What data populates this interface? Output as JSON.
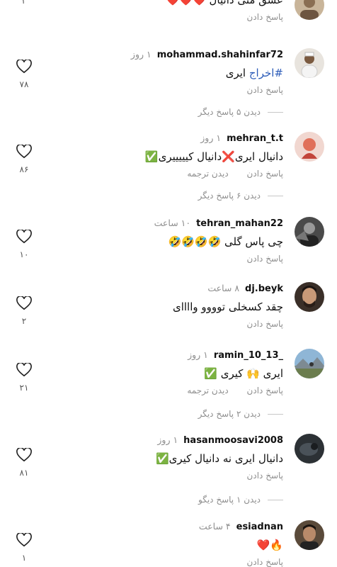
{
  "top_partial": {
    "text": "عشق منی دانیال ❤️❤️❤️",
    "reply": "پاسخ دادن",
    "likes": "۲"
  },
  "comments": [
    {
      "username": "mohammad.shahinfar72",
      "time": "۱ روز",
      "tag": "#اخراج",
      "text": " ایری",
      "actions": [
        "پاسخ دادن"
      ],
      "likes": "۷۸",
      "replies": "دیدن ۵ پاسخ دیگر"
    },
    {
      "username": "mehran_t.t",
      "time": "۱ روز",
      "text": "دانیال ایری❌دانیال کیییییری✅",
      "actions": [
        "پاسخ دادن",
        "دیدن ترجمه"
      ],
      "likes": "۸۶",
      "replies": "دیدن ۶ پاسخ دیگر"
    },
    {
      "username": "tehran_mahan22",
      "time": "۱۰ ساعت",
      "text": "چی پاس گلی 🤣🤣🤣🤣",
      "actions": [
        "پاسخ دادن"
      ],
      "likes": "۱۰"
    },
    {
      "username": "dj.beyk",
      "time": "۸ ساعت",
      "text": "چقد کسخلی توووو واااای",
      "actions": [
        "پاسخ دادن"
      ],
      "likes": "۲"
    },
    {
      "username": "ramin_10_13_",
      "time": "۱ روز",
      "text": "ایری 🙌 کیری ✅",
      "actions": [
        "پاسخ دادن",
        "دیدن ترجمه"
      ],
      "likes": "۲۱",
      "replies": "دیدن ۲ پاسخ دیگر"
    },
    {
      "username": "hasanmoosavi2008",
      "time": "۱ روز",
      "text": "دانیال ایری نه دانیال کیری✅",
      "actions": [
        "پاسخ دادن"
      ],
      "likes": "۸۱",
      "replies": "دیدن ۱ پاسخ دیگو"
    },
    {
      "username": "esiadnan",
      "time": "۴ ساعت",
      "text": "🔥❤️",
      "actions": [
        "پاسخ دادن"
      ],
      "likes": "۱"
    }
  ],
  "colors": {
    "hashtag": "#2b5bb8",
    "secondary_text": "#8e8e8e"
  }
}
